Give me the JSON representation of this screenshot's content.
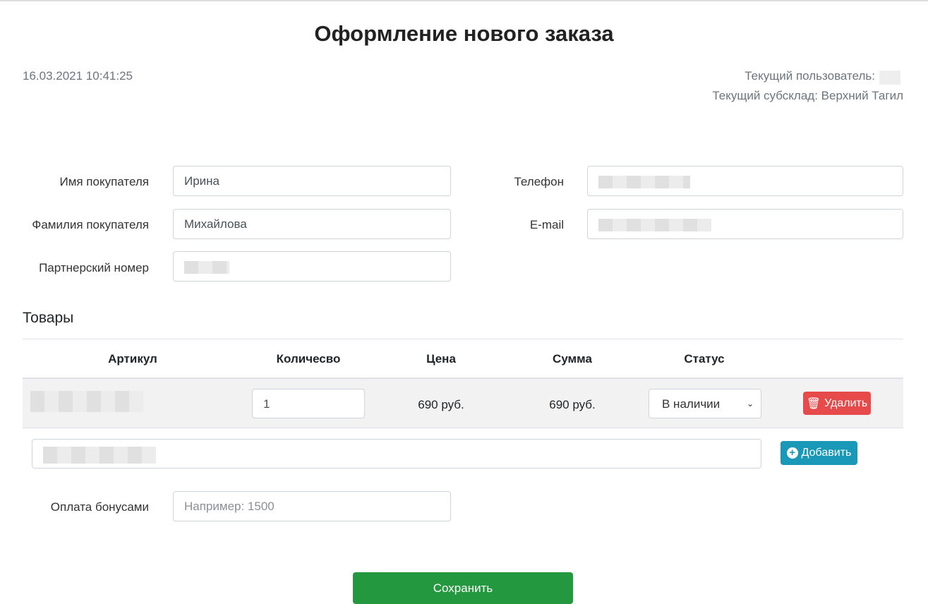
{
  "header": {
    "title": "Оформление нового заказа",
    "datetime": "16.03.2021 10:41:25",
    "current_user_label": "Текущий пользователь:",
    "current_subwarehouse": "Текущий субсклад: Верхний Тагил"
  },
  "form": {
    "first_name_label": "Имя покупателя",
    "first_name": "Ирина",
    "last_name_label": "Фамилия покупателя",
    "last_name": "Михайлова",
    "partner_label": "Партнерский номер",
    "phone_label": "Телефон",
    "email_label": "E-mail"
  },
  "goods": {
    "title": "Товары",
    "columns": [
      "Артикул",
      "Количесво",
      "Цена",
      "Сумма",
      "Статус"
    ],
    "rows": [
      {
        "quantity": "1",
        "price": "690 руб.",
        "sum": "690 руб.",
        "status": "В наличии",
        "delete_label": "Удалить"
      }
    ],
    "add_label": "Добавить"
  },
  "bonus": {
    "label": "Оплата бонусами",
    "placeholder": "Например: 1500"
  },
  "save_label": "Сохранить",
  "colors": {
    "danger": "#e74a4a",
    "info": "#1a98b8",
    "success": "#24983f"
  }
}
